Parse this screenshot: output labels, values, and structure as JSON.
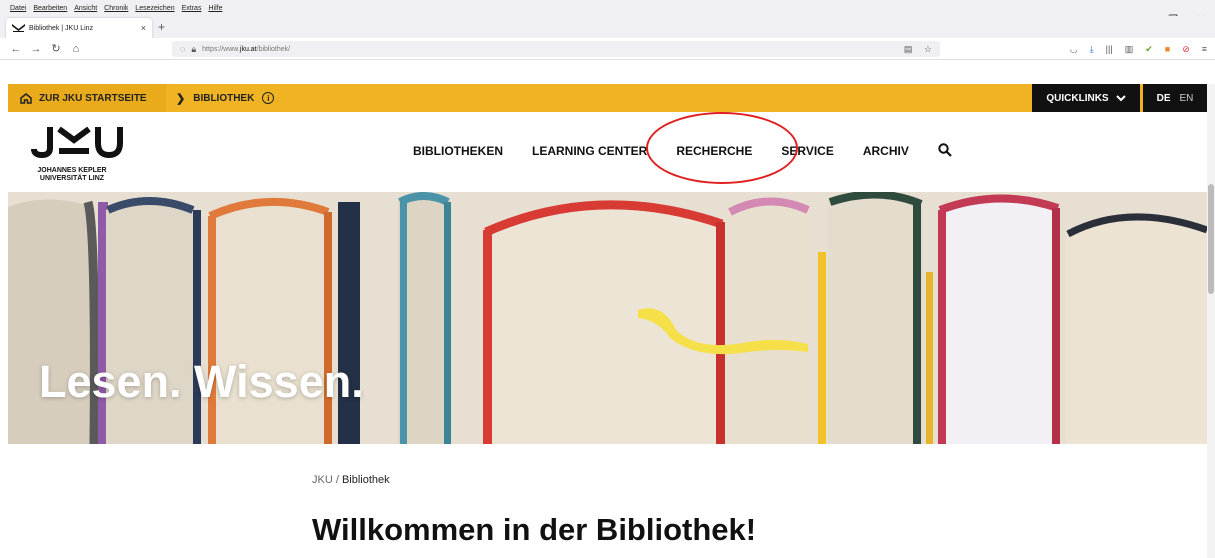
{
  "browser": {
    "menu_items": [
      "Datei",
      "Bearbeiten",
      "Ansicht",
      "Chronik",
      "Lesezeichen",
      "Extras",
      "Hilfe"
    ],
    "tab_title": "Bibliothek | JKU Linz",
    "tab_close": "×",
    "new_tab": "+",
    "url_prefix": "https://www.",
    "url_host": "jku.at",
    "url_path": "/bibliothek/",
    "window_controls": {
      "minimize": "–",
      "maximize": "❐",
      "close": "✕"
    }
  },
  "site": {
    "topbar": {
      "home_label": "ZUR JKU STARTSEITE",
      "crumb_label": "BIBLIOTHEK",
      "quicklinks_label": "QUICKLINKS",
      "lang_de": "DE",
      "lang_en": "EN"
    },
    "logo": {
      "text": "JKU",
      "subtitle_line1": "JOHANNES KEPLER",
      "subtitle_line2": "UNIVERSITÄT LINZ"
    },
    "nav": {
      "items": [
        "BIBLIOTHEKEN",
        "LEARNING CENTER",
        "RECHERCHE",
        "SERVICE",
        "ARCHIV"
      ]
    },
    "hero": {
      "headline": "Lesen. Wissen."
    },
    "breadcrumb": {
      "root": "JKU",
      "separator": "/",
      "current": "Bibliothek"
    },
    "page_title": "Willkommen in der Bibliothek!"
  },
  "colors": {
    "brand_yellow": "#f0b323",
    "dark": "#111111",
    "annotation_red": "#e02020"
  }
}
